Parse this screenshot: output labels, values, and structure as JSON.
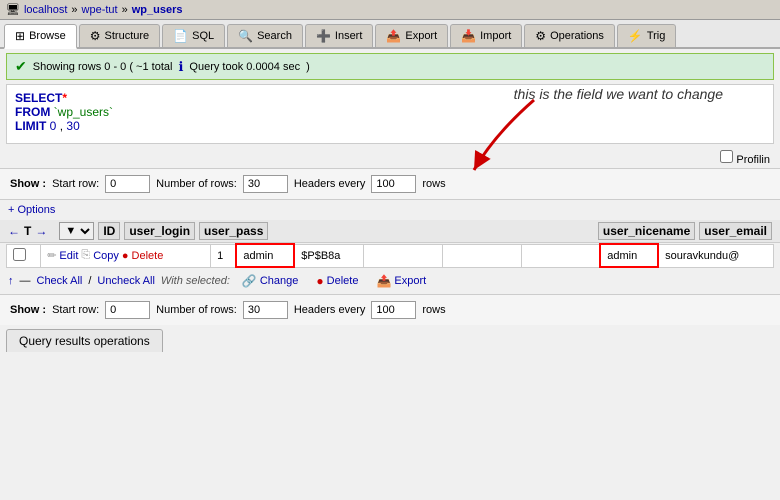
{
  "breadcrumb": {
    "server": "localhost",
    "sep1": "»",
    "db": "wpe-tut",
    "sep2": "»",
    "table": "wp_users"
  },
  "tabs": [
    {
      "label": "Browse",
      "icon": "⊞",
      "active": true
    },
    {
      "label": "Structure",
      "icon": "⚙"
    },
    {
      "label": "SQL",
      "icon": "📄"
    },
    {
      "label": "Search",
      "icon": "🔍"
    },
    {
      "label": "Insert",
      "icon": "➕"
    },
    {
      "label": "Export",
      "icon": "📤"
    },
    {
      "label": "Import",
      "icon": "📥"
    },
    {
      "label": "Operations",
      "icon": "⚙"
    },
    {
      "label": "Trig",
      "icon": "⚡"
    }
  ],
  "status": {
    "icon": "✔",
    "text": "Showing rows 0 - 0  ( ~1 total",
    "info_icon": "ℹ",
    "time_text": "Query took 0.0004 sec"
  },
  "sql_editor": {
    "line1_keyword": "SELECT",
    "line1_asterisk": "*",
    "line2_keyword": "FROM",
    "line2_table": "`wp_users`",
    "line3_keyword": "LIMIT",
    "line3_num1": "0",
    "line3_sep": ",",
    "line3_num2": "30"
  },
  "annotation": {
    "text": "this is the field we want to change"
  },
  "profiling_label": "Profilin",
  "show_top": {
    "label": "Show :",
    "start_row_label": "Start row:",
    "start_row_value": "0",
    "num_rows_label": "Number of rows:",
    "num_rows_value": "30",
    "headers_label": "Headers every",
    "headers_value": "100",
    "rows_label": "rows"
  },
  "options_label": "+ Options",
  "nav": {
    "back_icon": "←",
    "table_icon": "T",
    "forward_icon": "→",
    "sort_icon": "▼"
  },
  "table": {
    "columns": [
      "",
      "",
      "ID",
      "user_login",
      "user_pass",
      "",
      "",
      "",
      "user_nicename",
      "user_email"
    ],
    "rows": [
      {
        "checkbox": "",
        "actions": [
          "Edit",
          "Copy",
          "Delete"
        ],
        "id": "1",
        "user_login": "admin",
        "user_pass": "$P$B8a",
        "user_nicename": "admin",
        "user_email": "souravkundu@"
      }
    ]
  },
  "check_all": {
    "check_all_label": "Check All",
    "sep": "/",
    "uncheck_label": "Uncheck All",
    "with_selected": "With selected:",
    "change_label": "Change",
    "delete_label": "Delete",
    "export_label": "Export"
  },
  "show_bottom": {
    "label": "Show :",
    "start_row_label": "Start row:",
    "start_row_value": "0",
    "num_rows_label": "Number of rows:",
    "num_rows_value": "30",
    "headers_label": "Headers every",
    "headers_value": "100",
    "rows_label": "rows"
  },
  "qro_tab": "Query results operations"
}
